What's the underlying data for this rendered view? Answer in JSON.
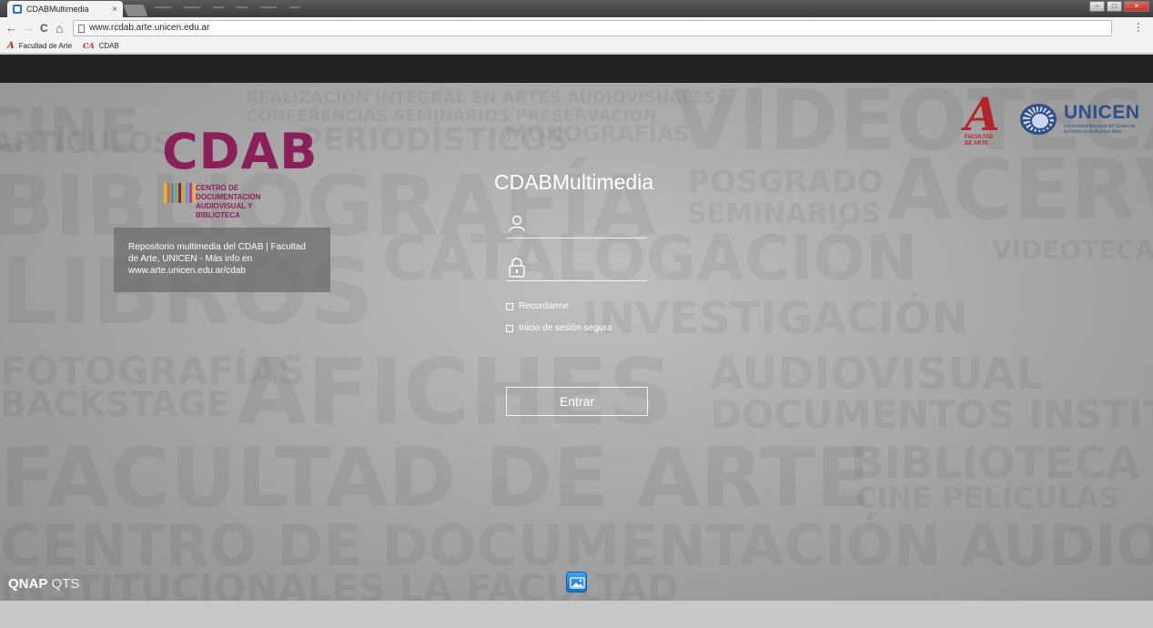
{
  "browser": {
    "tab_title": "CDABMultimedia",
    "tab_close": "×",
    "nav_back": "←",
    "nav_forward": "→",
    "nav_reload": "C",
    "nav_home": "⌂",
    "url": "www.rcdab.arte.unicen.edu.ar",
    "menu_dots": "⋮",
    "bookmarks": [
      {
        "label": "Facultad de Arte",
        "icon_text": "A"
      },
      {
        "label": "CDAB",
        "icon_text": "CA"
      }
    ],
    "window_buttons": {
      "minimize": "–",
      "maximize": "□",
      "close": "×"
    }
  },
  "header": {
    "cdab_logo": "CDAB",
    "cdab_subtitle": "CENTRO DE DOCUMENTACION AUDIOVISUAL Y BIBLIOTECA",
    "facultad_logo": "A",
    "facultad_caption": "FACULTAD DE ARTE",
    "unicen_name": "UNICEN",
    "unicen_subtitle": "Universidad Nacional del Centro de la Provincia de Buenos Aires"
  },
  "info": {
    "text": "Repositorio multimedia del CDAB | Facultad de Arte, UNICEN - Más info en www.arte.unicen.edu.ar/cdab"
  },
  "login": {
    "title": "CDABMultimedia",
    "username_placeholder": "",
    "password_placeholder": "",
    "remember_label": "Recordarme",
    "secure_label": "Inicio de sesión segura",
    "submit_label": "Entrar"
  },
  "footer": {
    "brand": "QNAP",
    "product": "QTS"
  },
  "colors": {
    "brand_magenta": "#8b1f5a",
    "facultad_red": "#b5232b",
    "unicen_blue": "#2d4f8a",
    "dark_bar": "#232323"
  }
}
